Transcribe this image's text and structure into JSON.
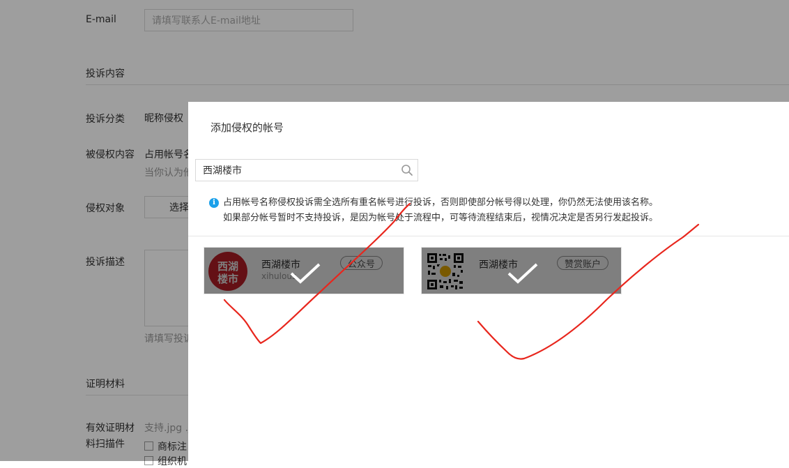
{
  "form": {
    "email_label": "E-mail",
    "email_placeholder": "请填写联系人E-mail地址",
    "section_content": "投诉内容",
    "category_label": "投诉分类",
    "category_value": "昵称侵权",
    "infringed_label": "被侵权内容",
    "infringed_value": "占用帐号名",
    "infringed_hint": "当你认为他",
    "target_label": "侵权对象",
    "target_button": "选择",
    "desc_label": "投诉描述",
    "desc_hint": "请填写投诉",
    "section_proof": "证明材料",
    "proof_label_line1": "有效证明材",
    "proof_label_line2": "料扫描件",
    "proof_hint": "支持.jpg .j",
    "checkbox1_label": "商标注",
    "checkbox2_label": "组织机"
  },
  "dialog": {
    "title": "添加侵权的帐号",
    "search_value": "西湖楼市",
    "notice_line1": "占用帐号名称侵权投诉需全选所有重名帐号进行投诉，否则即使部分帐号得以处理，你仍然无法使用该名称。",
    "notice_line2": "如果部分帐号暂时不支持投诉，是因为帐号处于流程中，可等待流程结束后，视情况决定是否另行发起投诉。",
    "info_icon_text": "i",
    "cards": [
      {
        "name": "西湖楼市",
        "sub": "xihulous",
        "tag": "公众号",
        "avatar_text_1": "西湖",
        "avatar_text_2": "楼市",
        "selected": true
      },
      {
        "name": "西湖楼市",
        "sub": "",
        "tag": "赞赏账户",
        "selected": true
      }
    ]
  },
  "colors": {
    "info_blue": "#1aa0ea",
    "avatar_red": "#c8202a",
    "scribble_red": "#e8261d"
  },
  "icons": {
    "search": "search-icon",
    "info": "info-icon",
    "check": "check-icon"
  }
}
